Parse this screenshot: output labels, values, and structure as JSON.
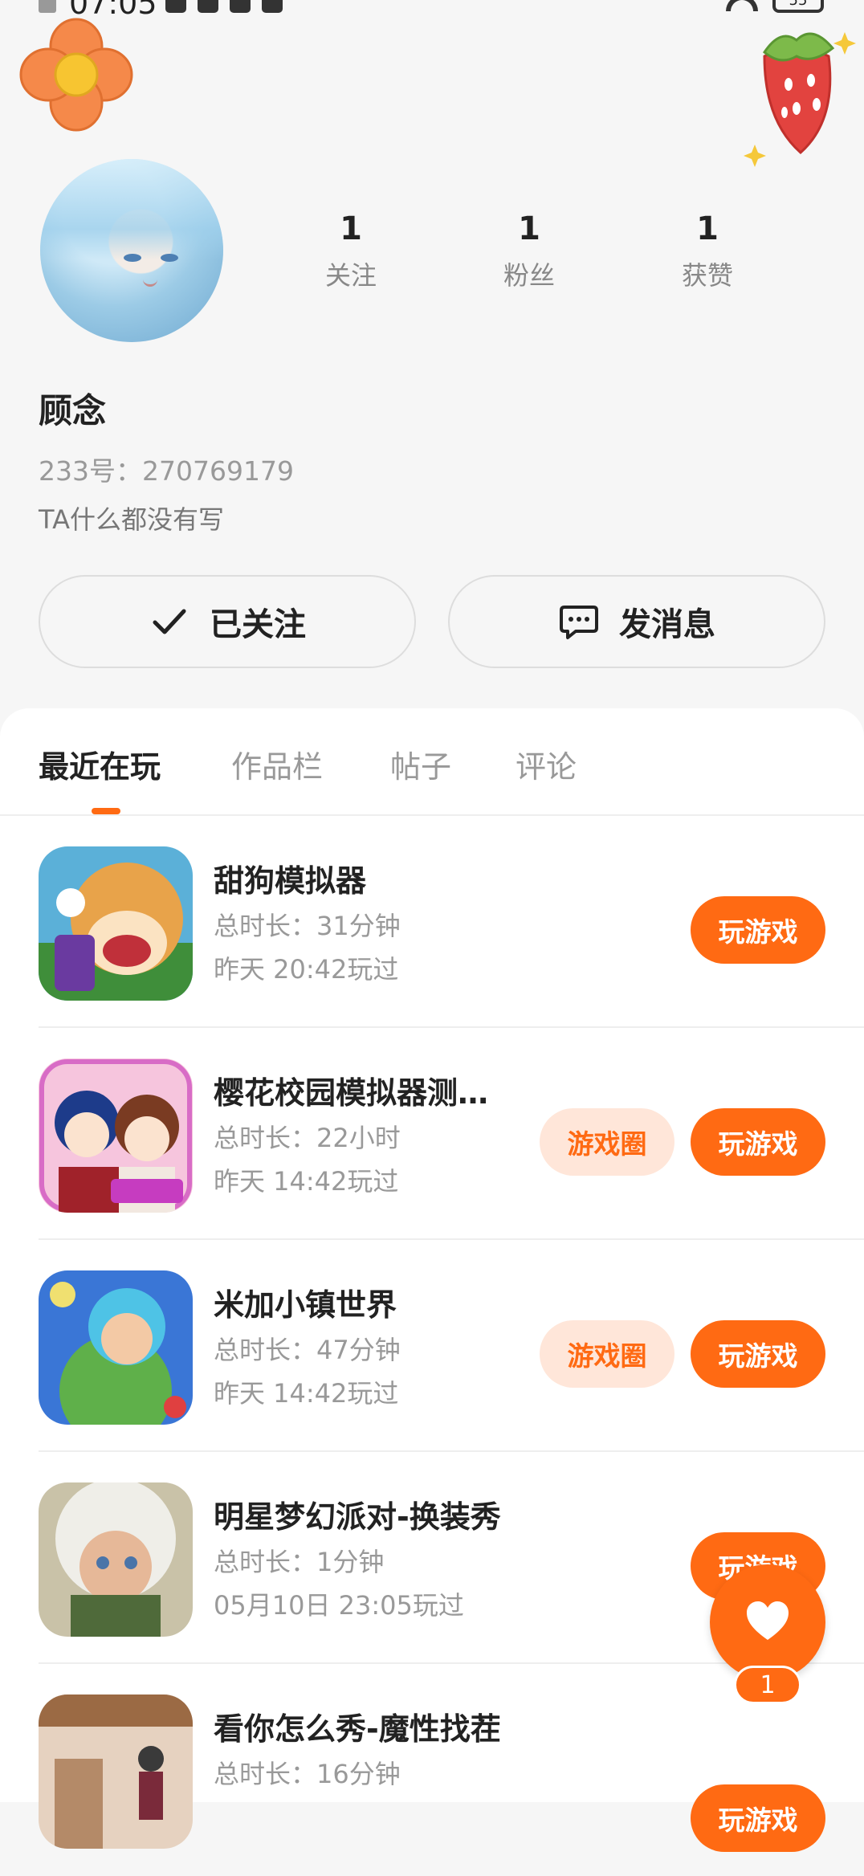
{
  "status_bar": {
    "time": "07:05",
    "battery": "55"
  },
  "profile": {
    "stats": [
      {
        "value": "1",
        "label": "关注"
      },
      {
        "value": "1",
        "label": "粉丝"
      },
      {
        "value": "1",
        "label": "获赞"
      }
    ],
    "name": "顾念",
    "id_line": "233号：270769179",
    "bio": "TA什么都没有写"
  },
  "actions": {
    "follow_label": "已关注",
    "message_label": "发消息"
  },
  "tabs": [
    {
      "label": "最近在玩",
      "active": true
    },
    {
      "label": "作品栏",
      "active": false
    },
    {
      "label": "帖子",
      "active": false
    },
    {
      "label": "评论",
      "active": false
    }
  ],
  "games": [
    {
      "title": "甜狗模拟器",
      "duration": "总时长：31分钟",
      "last_played": "昨天 20:42玩过",
      "has_circle": false,
      "icon": "shiba-dog-game-icon"
    },
    {
      "title": "樱花校园模拟器测…",
      "duration": "总时长：22小时",
      "last_played": "昨天 14:42玩过",
      "has_circle": true,
      "icon": "sakura-school-game-icon"
    },
    {
      "title": "米加小镇世界",
      "duration": "总时长：47分钟",
      "last_played": "昨天 14:42玩过",
      "has_circle": true,
      "icon": "miga-town-game-icon"
    },
    {
      "title": "明星梦幻派对-换装秀",
      "duration": "总时长：1分钟",
      "last_played": "05月10日 23:05玩过",
      "has_circle": false,
      "icon": "star-party-game-icon"
    },
    {
      "title": "看你怎么秀-魔性找茬",
      "duration": "总时长：16分钟",
      "last_played": "",
      "has_circle": false,
      "icon": "spot-difference-game-icon"
    }
  ],
  "labels": {
    "play": "玩游戏",
    "circle": "游戏圈"
  },
  "fab": {
    "count": "1"
  },
  "colors": {
    "accent": "#ff6a13",
    "accent_light": "#ffe6d9"
  }
}
